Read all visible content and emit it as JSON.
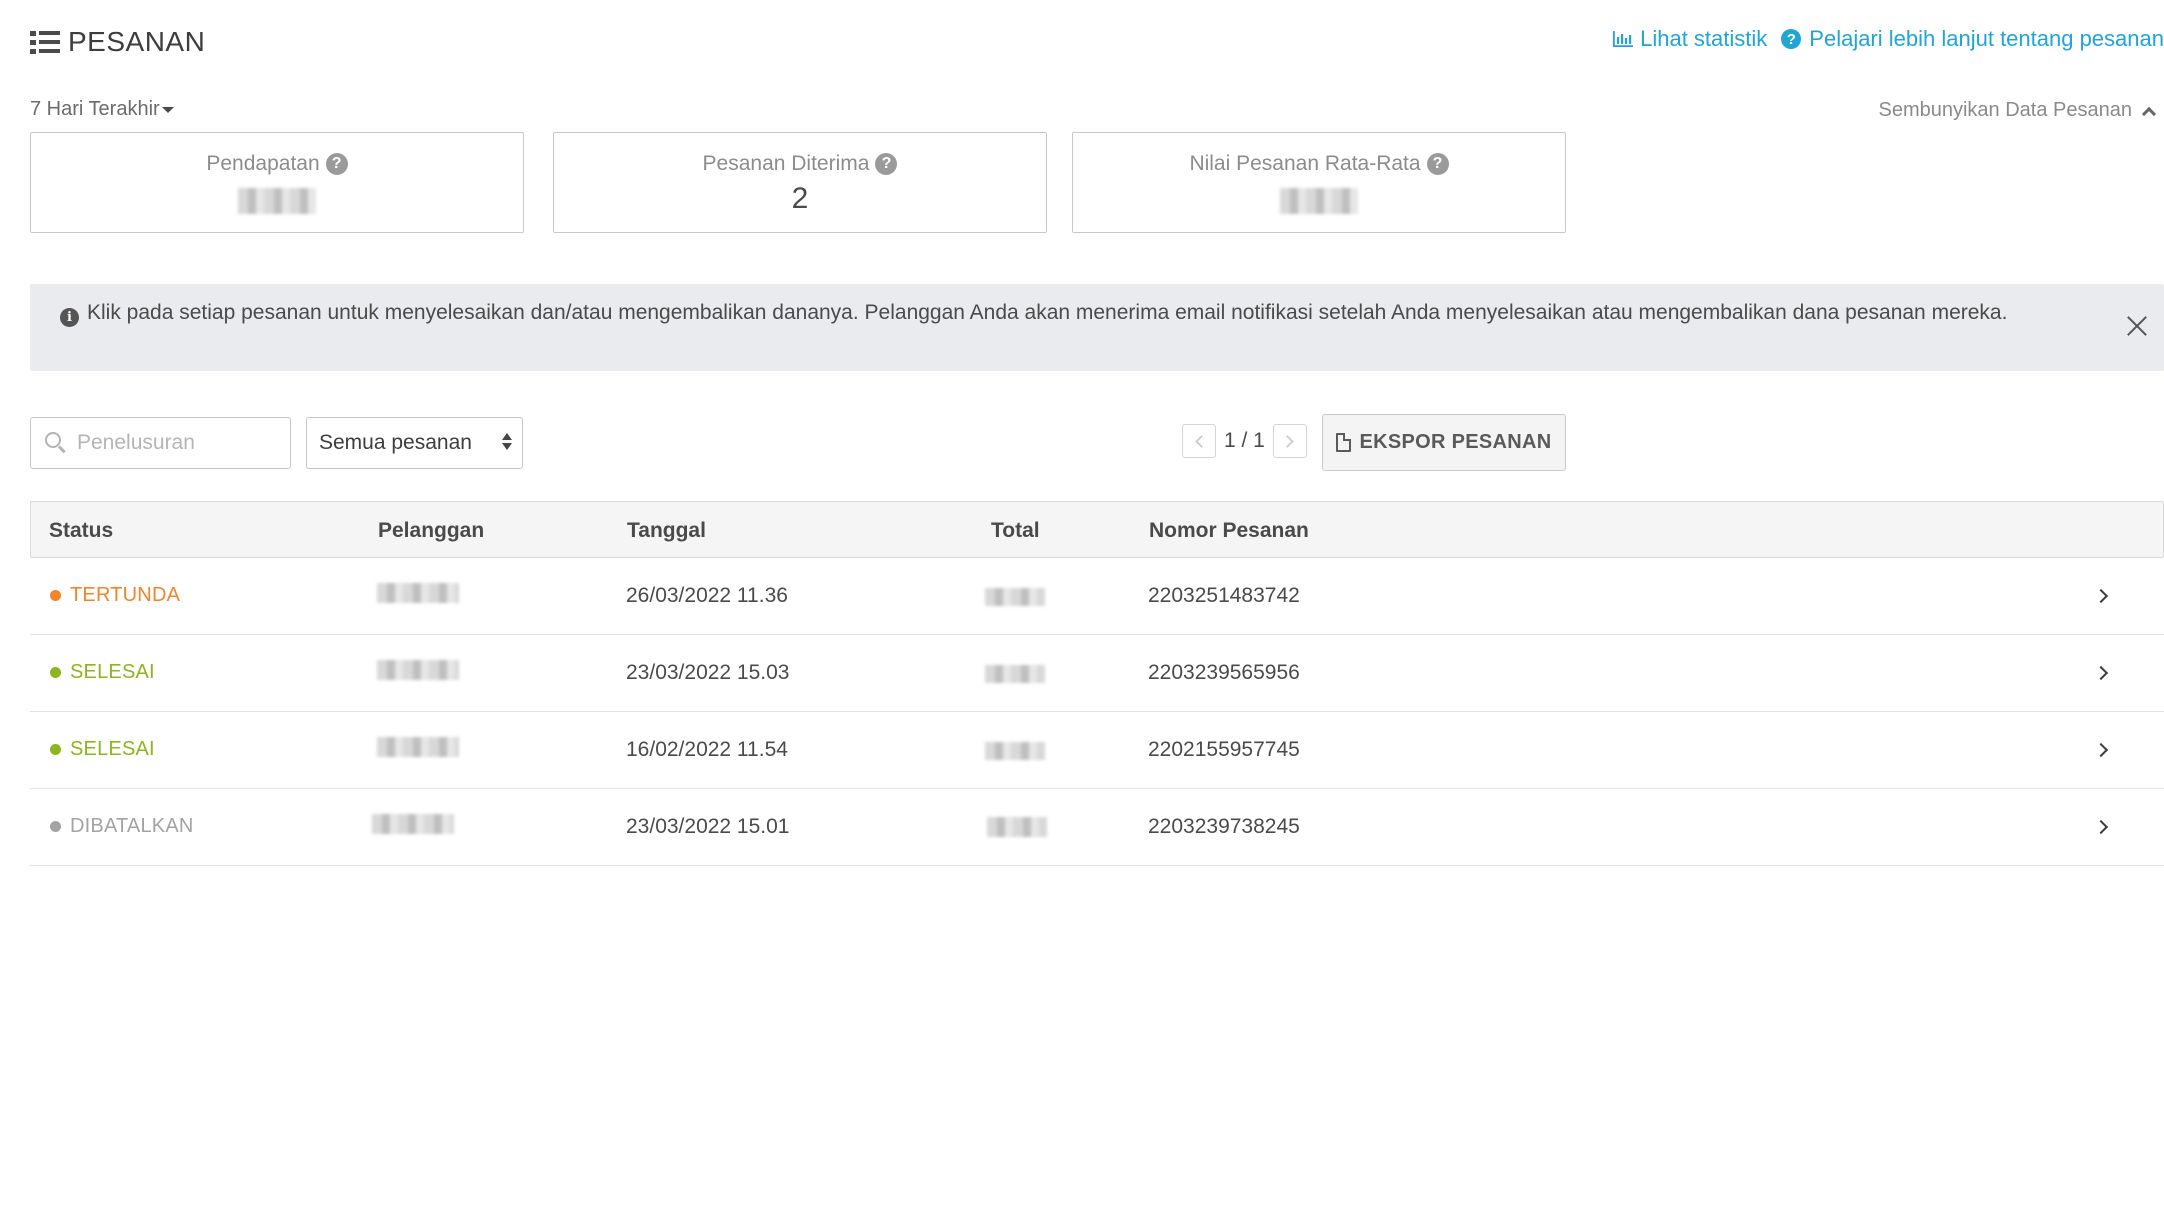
{
  "header": {
    "title": "PESANAN",
    "stats_link": "Lihat statistik",
    "help_link": "Pelajari lebih lanjut tentang pesanan"
  },
  "summary": {
    "period": "7 Hari Terakhir",
    "hide_label": "Sembunyikan Data Pesanan",
    "cards": [
      {
        "label": "Pendapatan",
        "value": ""
      },
      {
        "label": "Pesanan Diterima",
        "value": "2"
      },
      {
        "label": "Nilai Pesanan Rata-Rata",
        "value": ""
      }
    ]
  },
  "notice": {
    "text": "Klik pada setiap pesanan untuk menyelesaikan dan/atau mengembalikan dananya. Pelanggan Anda akan menerima email notifikasi setelah Anda menyelesaikan atau mengembalikan dana pesanan mereka."
  },
  "toolbar": {
    "search_placeholder": "Penelusuran",
    "filter_value": "Semua pesanan",
    "page_indicator": "1 / 1",
    "export_label": "EKSPOR PESANAN"
  },
  "table": {
    "columns": [
      "Status",
      "Pelanggan",
      "Tanggal",
      "Total",
      "Nomor Pesanan"
    ],
    "rows": [
      {
        "status": "TERTUNDA",
        "status_color": "#f5832a",
        "date": "26/03/2022 11.36",
        "order_number": "2203251483742"
      },
      {
        "status": "SELESAI",
        "status_color": "#8db51e",
        "date": "23/03/2022 15.03",
        "order_number": "2203239565956"
      },
      {
        "status": "SELESAI",
        "status_color": "#8db51e",
        "date": "16/02/2022 11.54",
        "order_number": "2202155957745"
      },
      {
        "status": "DIBATALKAN",
        "status_color": "#a3a3a3",
        "date": "23/03/2022 15.01",
        "order_number": "2203239738245"
      }
    ]
  },
  "colors": {
    "link": "#1fa5d6",
    "pending": "#f5832a",
    "done": "#8db51e",
    "cancelled": "#a3a3a3"
  }
}
